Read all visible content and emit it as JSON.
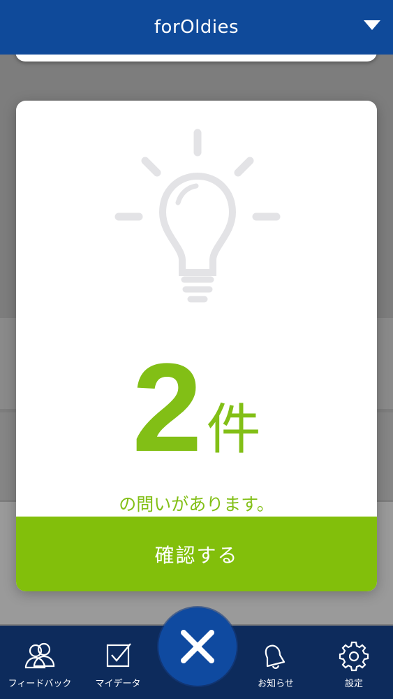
{
  "header": {
    "title": "forOldies",
    "dropdown_icon": "triangle-down-icon"
  },
  "modal": {
    "icon": "lightbulb-icon",
    "count": "2",
    "count_unit": "件",
    "message": "の問いがあります。",
    "confirm_label": "確認する",
    "accent_color": "#82bf0b"
  },
  "close_button": {
    "icon": "close-x-icon"
  },
  "bottom_nav": {
    "items": [
      {
        "label": "フィードバック",
        "icon": "people-icon"
      },
      {
        "label": "マイデータ",
        "icon": "checkbox-icon"
      },
      {
        "label": "お知らせ",
        "icon": "bell-icon"
      },
      {
        "label": "設定",
        "icon": "gear-icon"
      }
    ],
    "background": "#0d2b5c"
  },
  "colors": {
    "header": "#0f4a9a",
    "overlay": "#7d7d7d"
  }
}
